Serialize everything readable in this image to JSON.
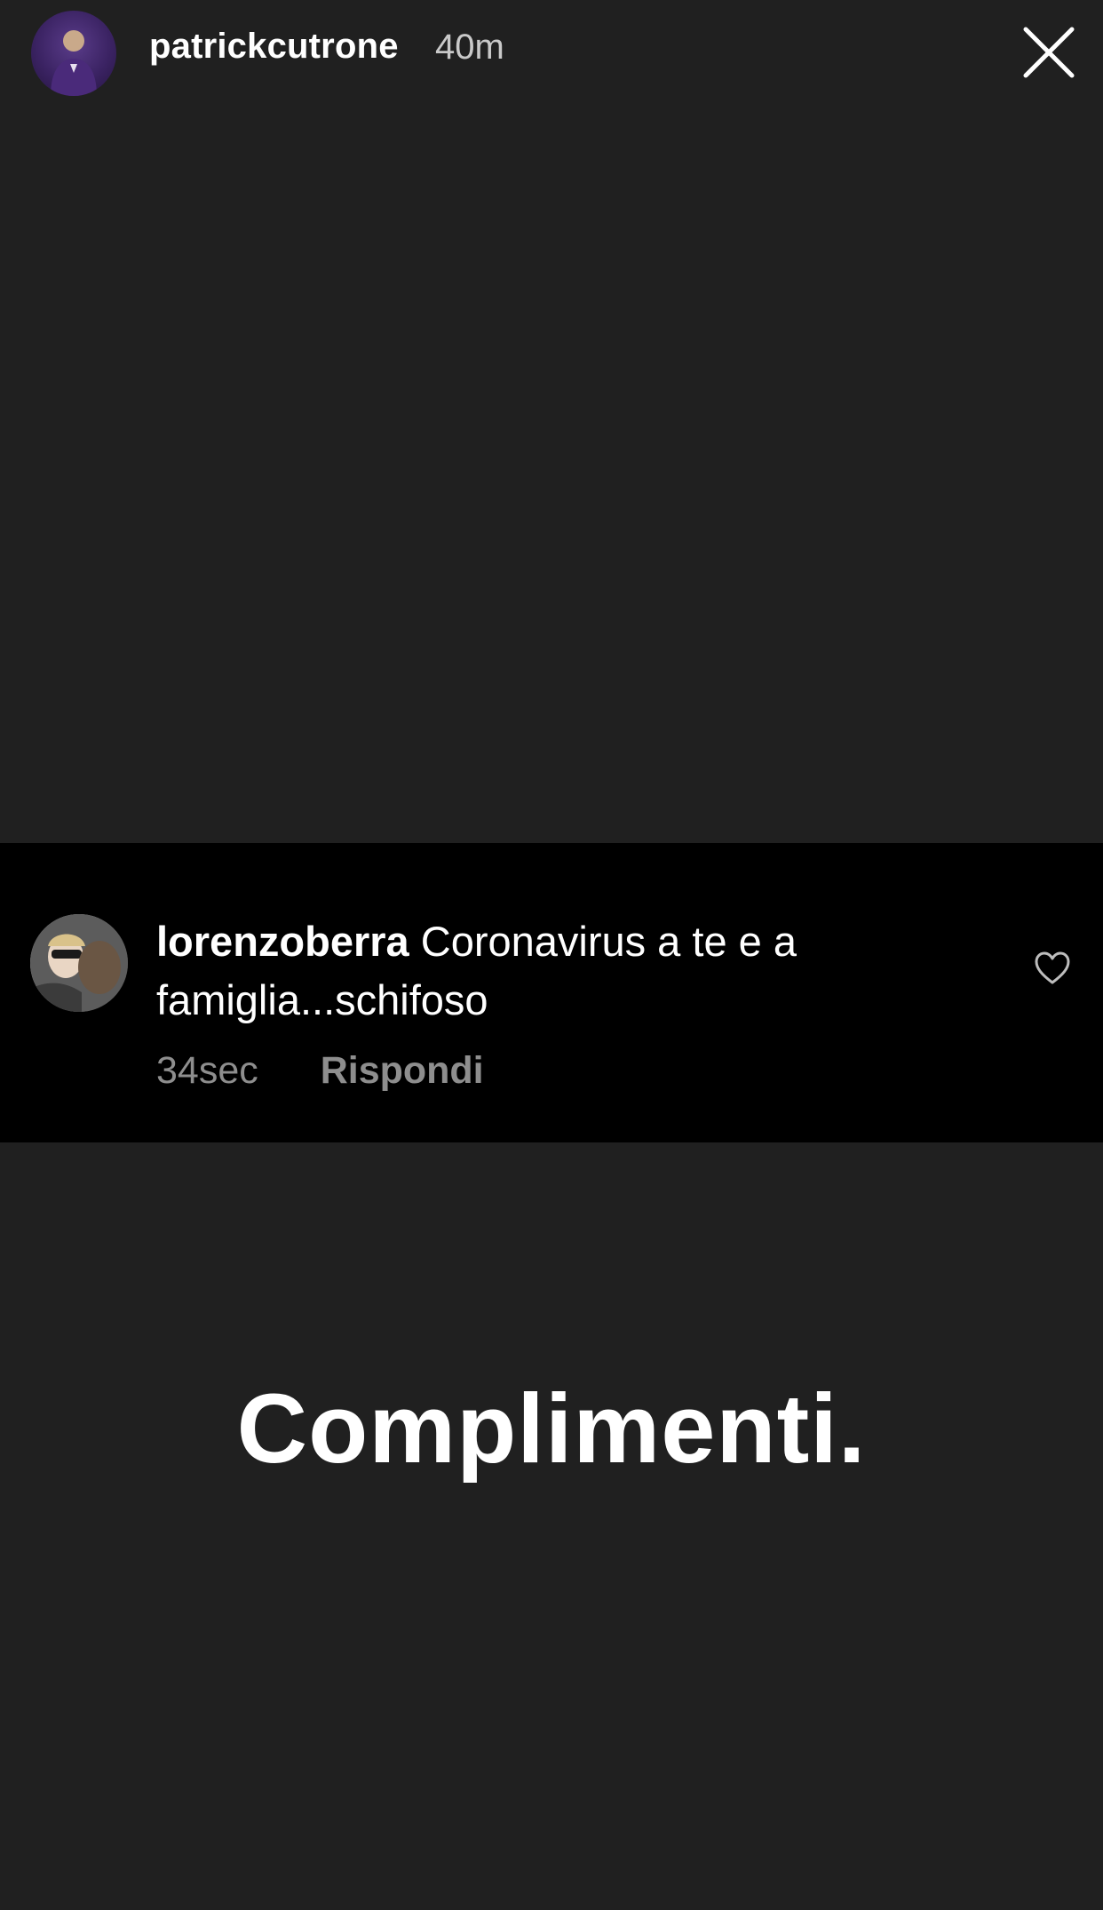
{
  "header": {
    "avatar_icon": "profile-photo-avatar",
    "username": "patrickcutrone",
    "time": "40m",
    "close_icon": "close-x-icon"
  },
  "comment": {
    "avatar_icon": "profile-photo-avatar",
    "username": "lorenzoberra",
    "text": " Coronavirus a te e a famiglia...schifoso",
    "time": "34sec",
    "reply_label": "Rispondi",
    "like_icon": "heart-outline-icon"
  },
  "story_text": "Complimenti.",
  "colors": {
    "background": "#202020",
    "comment_band": "#000000",
    "muted_text": "#8e8e8e"
  }
}
